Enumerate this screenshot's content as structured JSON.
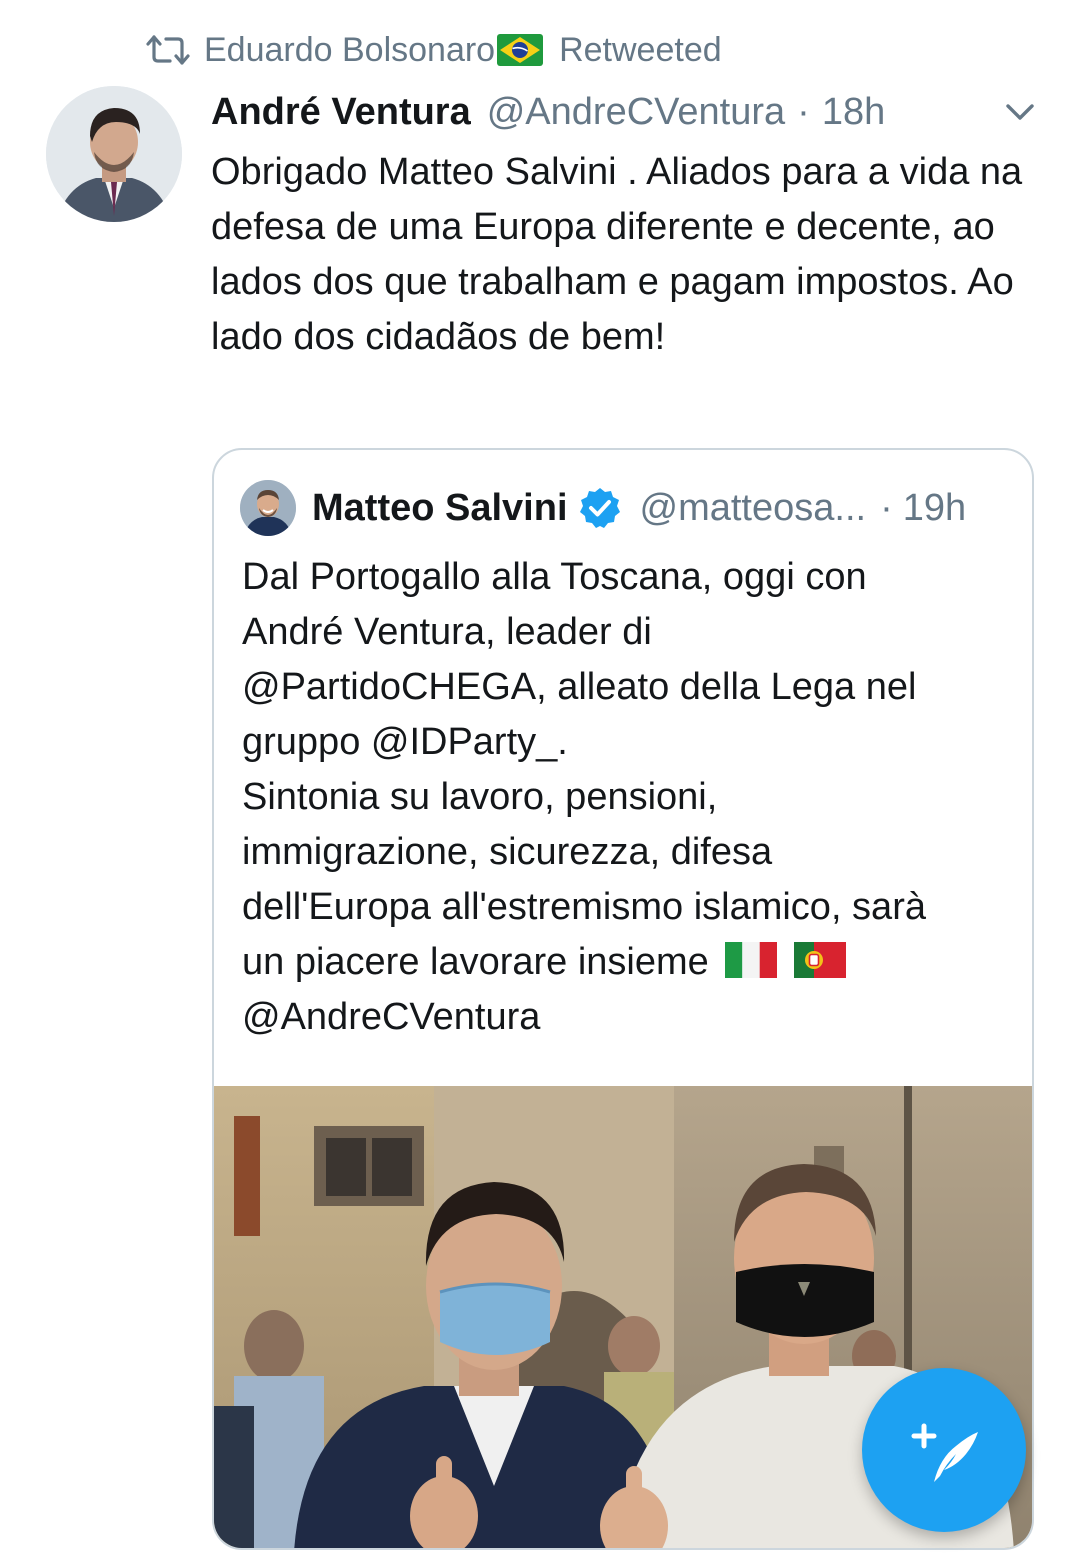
{
  "retweet_context": {
    "retweeter_name": "Eduardo Bolsonaro",
    "retweeted_label": "Retweeted",
    "flag_icon": "brazil-flag-icon"
  },
  "tweet": {
    "author_name": "André Ventura",
    "author_handle": "@AndreCVentura",
    "separator": "·",
    "time": "18h",
    "text": "Obrigado Matteo Salvini . Aliados para a vida na defesa de uma Europa diferente e decente, ao lados dos que trabalham e pagam impostos. Ao lado dos cidadãos de bem!"
  },
  "quoted_tweet": {
    "author_name": "Matteo Salvini",
    "author_handle": "@matteosa...",
    "separator": "·",
    "time": "19h",
    "verified": true,
    "text_lines": [
      "Dal Portogallo alla Toscana, oggi con",
      "André Ventura, leader di",
      "@PartidoCHEGA, alleato della Lega nel",
      "gruppo @IDParty_.",
      "Sintonia su lavoro, pensioni,",
      "immigrazione, sicurezza, difesa",
      "dell'Europa all'estremismo islamico, sarà",
      "un piacere lavorare insieme",
      "@AndreCVentura"
    ],
    "flags": [
      "italy-flag-icon",
      "portugal-flag-icon"
    ]
  },
  "colors": {
    "accent": "#1da1f2",
    "secondary_text": "#657786",
    "primary_text": "#14171a",
    "border": "#ccd6dd"
  },
  "icons": {
    "retweet": "retweet-icon",
    "caret": "chevron-down-icon",
    "verified": "verified-badge-icon",
    "compose": "compose-tweet-icon"
  }
}
